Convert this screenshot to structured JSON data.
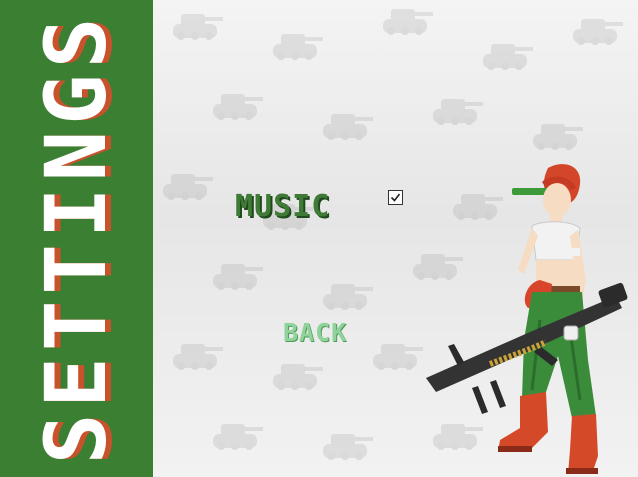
{
  "sidebar": {
    "title": "SETTINGS"
  },
  "menu": {
    "music_label": "MUSIC",
    "music_enabled": true,
    "back_label": "BACK"
  },
  "colors": {
    "sidebar_green": "#3b7f33",
    "title_shadow": "#c8522c",
    "music_text": "#3f7b36",
    "back_text": "#8fd39a"
  },
  "icons": {
    "checkbox": "checkmark-icon",
    "character": "soldier-character",
    "background": "tank-pattern"
  }
}
